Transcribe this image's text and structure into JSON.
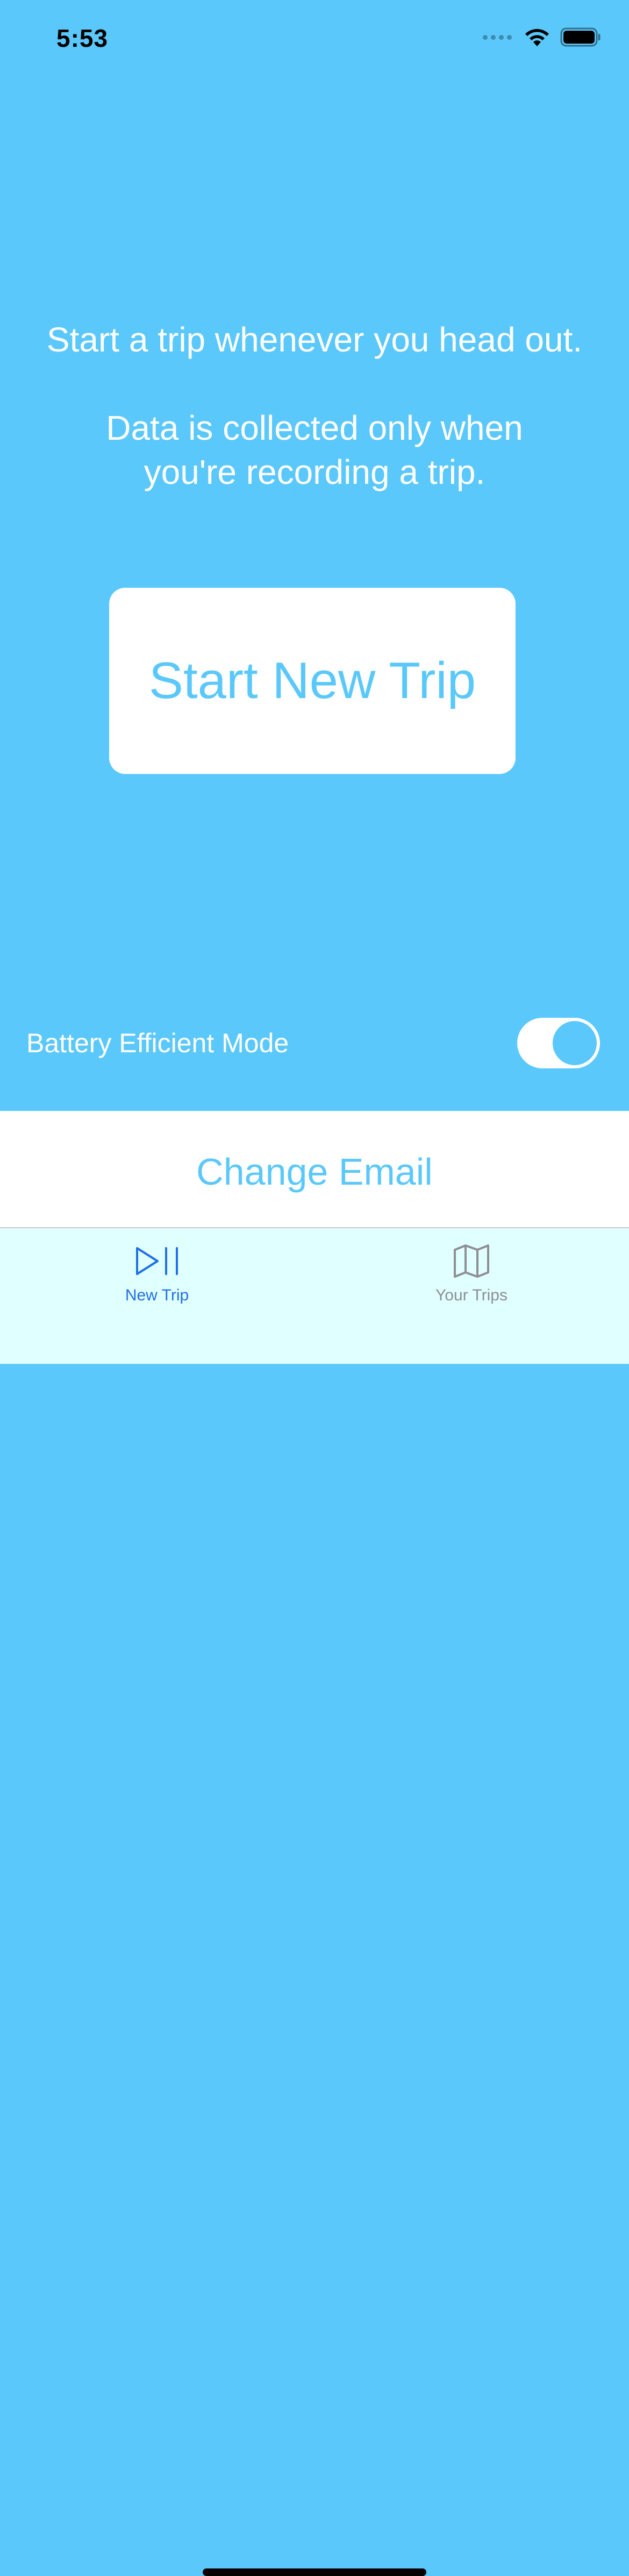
{
  "status_bar": {
    "time": "5:53",
    "icons": [
      "cellular-signal-icon",
      "wifi-icon",
      "battery-icon"
    ]
  },
  "main": {
    "intro_line_1": "Start a trip whenever you head out.",
    "intro_line_2": "Data is collected only when",
    "intro_line_3": "you're recording a trip.",
    "start_button_label": "Start New Trip",
    "battery_mode": {
      "label": "Battery Efficient Mode",
      "enabled": true
    }
  },
  "email": {
    "change_email_label": "Change Email"
  },
  "tab_bar": {
    "tabs": [
      {
        "label": "New Trip",
        "icon": "play-pause-icon",
        "selected": true
      },
      {
        "label": "Your Trips",
        "icon": "map-icon",
        "selected": false
      }
    ]
  },
  "colors": {
    "background": "#5ac8fa",
    "button_text": "#5ac8fa",
    "tab_bar_background": "#e0ffff",
    "tab_selected": "#1f6fe8",
    "tab_unselected": "#8e8e93"
  }
}
